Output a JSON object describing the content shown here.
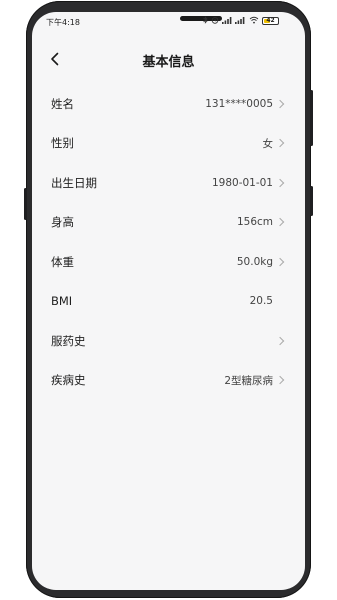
{
  "status_bar": {
    "time": "下午4:18",
    "icons": [
      "bluetooth-icon",
      "alarm-icon",
      "signal-icon",
      "hd-signal-icon",
      "wifi-icon",
      "battery-icon"
    ],
    "battery_level": "42"
  },
  "header": {
    "title": "基本信息",
    "back_icon": "chevron-left-icon"
  },
  "rows": [
    {
      "label": "姓名",
      "value": "131****0005",
      "chevron": true
    },
    {
      "label": "性别",
      "value": "女",
      "chevron": true
    },
    {
      "label": "出生日期",
      "value": "1980-01-01",
      "chevron": true
    },
    {
      "label": "身高",
      "value": "156cm",
      "chevron": true
    },
    {
      "label": "体重",
      "value": "50.0kg",
      "chevron": true
    },
    {
      "label": "BMI",
      "value": "20.5",
      "chevron": false
    },
    {
      "label": "服药史",
      "value": "",
      "chevron": true
    },
    {
      "label": "疾病史",
      "value": "2型糖尿病",
      "chevron": true
    }
  ],
  "colors": {
    "background": "#f6f6f7",
    "frame": "#2b2b2d",
    "text": "#1f1f1f",
    "battery": "#f0c000"
  }
}
